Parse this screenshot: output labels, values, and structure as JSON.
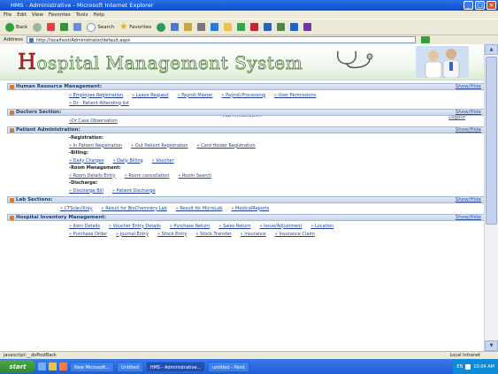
{
  "browser": {
    "title": "HMS - Administrative - Microsoft Internet Explorer",
    "menu": [
      "File",
      "Edit",
      "View",
      "Favorites",
      "Tools",
      "Help"
    ],
    "toolbar": {
      "back": "Back",
      "search": "Search",
      "favorites": "Favorites"
    },
    "address": {
      "label": "Address",
      "value": "http://localhost/Administrator/default.aspx"
    },
    "status": {
      "left": "javascript:__doPostBack",
      "right": "Local intranet"
    }
  },
  "header": {
    "logo_initial": "H",
    "logo_rest": "ospital Management System",
    "page_title": "Administration",
    "logout": "Logout"
  },
  "sections": [
    {
      "title": "Human Resource Management:",
      "show": "Show/Hide",
      "rows": [
        {
          "type": "links",
          "items": [
            "» Employee Registration",
            "» Leave Request",
            "» Payroll Master",
            "» Payroll Processing",
            "» User Permissions"
          ]
        },
        {
          "type": "links",
          "items": [
            "» Dr - Patient Attending list"
          ]
        }
      ]
    },
    {
      "title": "Doctors Section:",
      "show": "Show/Hide",
      "rows": [
        {
          "type": "links",
          "items": [
            "»Dr Case Observation"
          ]
        }
      ]
    },
    {
      "title": "Patient Administration:",
      "show": "Show/Hide",
      "rows": [
        {
          "type": "label",
          "text": "-Registration:"
        },
        {
          "type": "links",
          "items": [
            "» In Patient Registration",
            "» Out Patient Registration",
            "» Card Holder Registration"
          ]
        },
        {
          "type": "label",
          "text": "-Billing:"
        },
        {
          "type": "links",
          "items": [
            "» Daily Charges",
            "» Daily Billing",
            "» Voucher"
          ]
        },
        {
          "type": "label",
          "text": "-Room Management:"
        },
        {
          "type": "links",
          "items": [
            "» Room Details Entry",
            "» Room cancellation",
            "» Room Search"
          ]
        },
        {
          "type": "label",
          "text": "-Discharge:"
        },
        {
          "type": "links",
          "items": [
            "» Discharge Bill",
            "» Patient Discharge"
          ]
        }
      ]
    },
    {
      "title": "Lab Sections:",
      "show": "Show/Hide",
      "rows": [
        {
          "type": "links",
          "items": [
            "» CTScan/Xray",
            "» Result for BioChemistry Lab",
            "» Result for MicroLab",
            "» MedicalReports"
          ]
        }
      ]
    },
    {
      "title": "Hospital Inventory Management:",
      "show": "Show/Hide",
      "rows": [
        {
          "type": "links",
          "items": [
            "» Item Details",
            "» Voucher Entry Details",
            "» Purchase Return",
            "» Sales Return",
            "» Issue/Adjustment",
            "» Location"
          ]
        },
        {
          "type": "links",
          "items": [
            "» Purchase Order",
            "» Journal Entry",
            "» Stock Entry",
            "» Stock Transfer",
            "» Insurance",
            "» Insurance Claim"
          ]
        }
      ]
    }
  ],
  "taskbar": {
    "start": "start",
    "tasks": [
      "New Microsoft...",
      "Untitled",
      "HMS - Administrative...",
      "untitled - Paint",
      "EN"
    ],
    "clock": "10:04 AM"
  },
  "colors": {
    "accent": "#1e3a66",
    "link": "#1f3f9a",
    "logo_green": "#4d7a3b",
    "logo_red": "#b22222"
  }
}
